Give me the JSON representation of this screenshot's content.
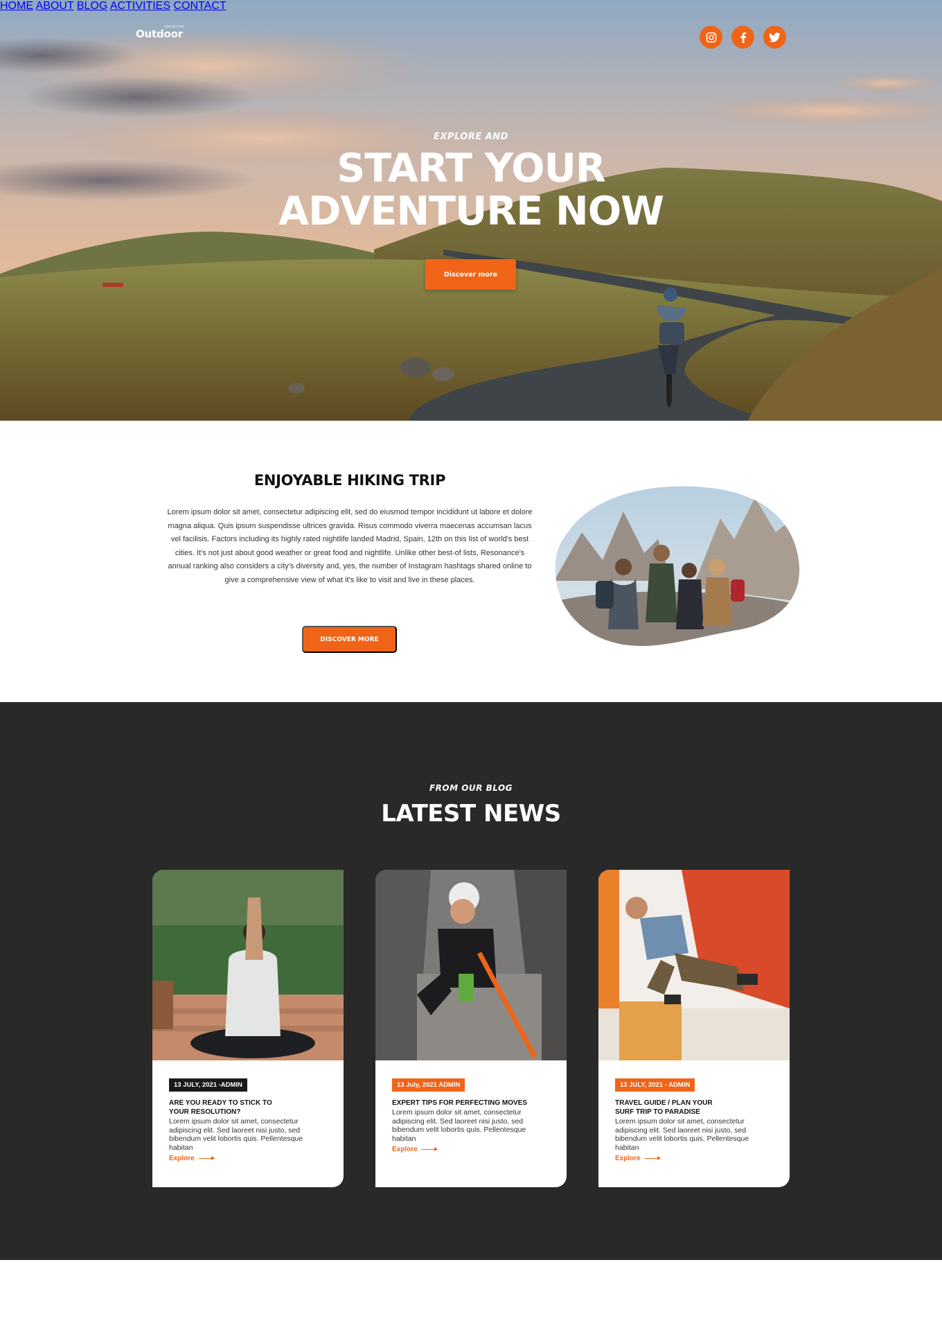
{
  "brand": {
    "name": "Outdoor",
    "tagline": "ADVENTURE"
  },
  "nav": {
    "items": [
      {
        "label": "HOME"
      },
      {
        "label": "ABOUT"
      },
      {
        "label": "BLOG"
      },
      {
        "label": "ACTIVITIES"
      },
      {
        "label": "CONTACT"
      }
    ],
    "social_icons": [
      "instagram-icon",
      "facebook-icon",
      "twitter-icon"
    ]
  },
  "hero": {
    "kicker": "EXPLORE AND",
    "headline_line1": "START YOUR",
    "headline_line2": "ADVENTURE NOW",
    "cta": "Discover more"
  },
  "about": {
    "title": "ENJOYABLE HIKING TRIP",
    "body": "Lorem ipsum dolor sit amet, consectetur adipiscing elit, sed do eiusmod tempor incididunt ut labore et dolore magna aliqua. Quis ipsum suspendisse ultrices gravida. Risus commodo viverra maecenas accumsan lacus vel facilisis. Factors including its highly rated nightlife landed Madrid, Spain, 12th on this list of world's best cities. It's not just about good weather or great food and nightlife. Unlike other best-of lists, Resonance's annual ranking also considers a city's diversity and, yes, the number of Instagram hashtags shared online to give a comprehensive view of what it's like to visit and live in these places.",
    "cta": "DISCOVER MORE"
  },
  "blog": {
    "kicker": "FROM OUR BLOG",
    "title": "LATEST NEWS",
    "posts": [
      {
        "tag": "13 JULY, 2021 -ADMIN",
        "title": "ARE YOU READY TO STICK TO YOUR RESOLUTION?",
        "excerpt": "Lorem ipsum dolor sit amet, consectetur adipiscing elit. Sed laoreet nisi justo, sed bibendum velit lobortis quis. Pellentesque habitan",
        "link": "Explore"
      },
      {
        "tag": "13 July, 2021 ADMIN",
        "title": "EXPERT TIPS FOR PERFECTING MOVES",
        "excerpt": "Lorem ipsum dolor sit amet, consectetur adipiscing elit. Sed laoreet nisi justo, sed bibendum velit lobortis quis. Pellentesque habitan",
        "link": "Explore"
      },
      {
        "tag": "13 JULY, 2021 - ADMIN",
        "title": "TRAVEL GUIDE / PLAN YOUR SURF TRIP TO PARADISE",
        "excerpt": "Lorem ipsum dolor sit amet, consectetur adipiscing elit. Sed laoreet nisi justo, sed bibendum velit lobortis quis. Pellentesque habitan",
        "link": "Explore"
      }
    ]
  },
  "colors": {
    "accent": "#f06418",
    "dark": "#292929",
    "tag_dark": "#1a1a1a"
  }
}
